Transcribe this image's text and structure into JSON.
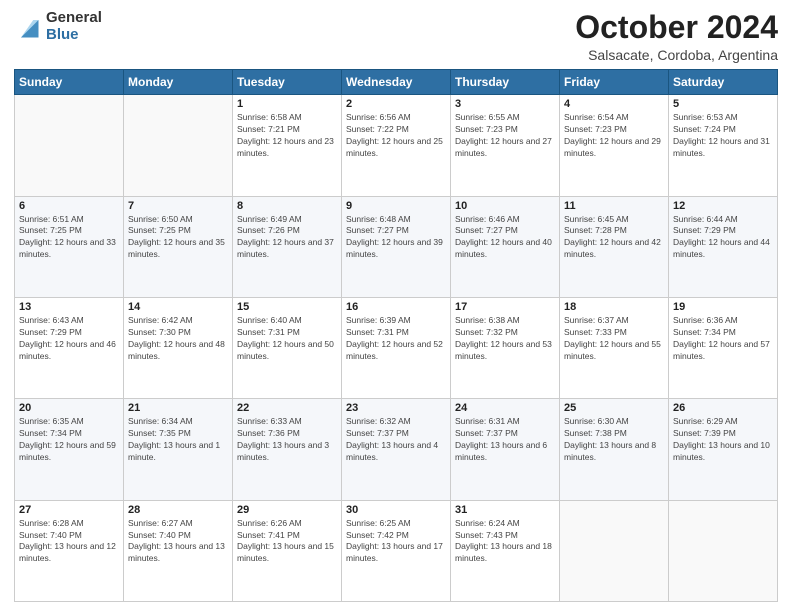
{
  "logo": {
    "general": "General",
    "blue": "Blue"
  },
  "header": {
    "title": "October 2024",
    "subtitle": "Salsacate, Cordoba, Argentina"
  },
  "weekdays": [
    "Sunday",
    "Monday",
    "Tuesday",
    "Wednesday",
    "Thursday",
    "Friday",
    "Saturday"
  ],
  "weeks": [
    [
      {
        "day": "",
        "info": ""
      },
      {
        "day": "",
        "info": ""
      },
      {
        "day": "1",
        "info": "Sunrise: 6:58 AM\nSunset: 7:21 PM\nDaylight: 12 hours and 23 minutes."
      },
      {
        "day": "2",
        "info": "Sunrise: 6:56 AM\nSunset: 7:22 PM\nDaylight: 12 hours and 25 minutes."
      },
      {
        "day": "3",
        "info": "Sunrise: 6:55 AM\nSunset: 7:23 PM\nDaylight: 12 hours and 27 minutes."
      },
      {
        "day": "4",
        "info": "Sunrise: 6:54 AM\nSunset: 7:23 PM\nDaylight: 12 hours and 29 minutes."
      },
      {
        "day": "5",
        "info": "Sunrise: 6:53 AM\nSunset: 7:24 PM\nDaylight: 12 hours and 31 minutes."
      }
    ],
    [
      {
        "day": "6",
        "info": "Sunrise: 6:51 AM\nSunset: 7:25 PM\nDaylight: 12 hours and 33 minutes."
      },
      {
        "day": "7",
        "info": "Sunrise: 6:50 AM\nSunset: 7:25 PM\nDaylight: 12 hours and 35 minutes."
      },
      {
        "day": "8",
        "info": "Sunrise: 6:49 AM\nSunset: 7:26 PM\nDaylight: 12 hours and 37 minutes."
      },
      {
        "day": "9",
        "info": "Sunrise: 6:48 AM\nSunset: 7:27 PM\nDaylight: 12 hours and 39 minutes."
      },
      {
        "day": "10",
        "info": "Sunrise: 6:46 AM\nSunset: 7:27 PM\nDaylight: 12 hours and 40 minutes."
      },
      {
        "day": "11",
        "info": "Sunrise: 6:45 AM\nSunset: 7:28 PM\nDaylight: 12 hours and 42 minutes."
      },
      {
        "day": "12",
        "info": "Sunrise: 6:44 AM\nSunset: 7:29 PM\nDaylight: 12 hours and 44 minutes."
      }
    ],
    [
      {
        "day": "13",
        "info": "Sunrise: 6:43 AM\nSunset: 7:29 PM\nDaylight: 12 hours and 46 minutes."
      },
      {
        "day": "14",
        "info": "Sunrise: 6:42 AM\nSunset: 7:30 PM\nDaylight: 12 hours and 48 minutes."
      },
      {
        "day": "15",
        "info": "Sunrise: 6:40 AM\nSunset: 7:31 PM\nDaylight: 12 hours and 50 minutes."
      },
      {
        "day": "16",
        "info": "Sunrise: 6:39 AM\nSunset: 7:31 PM\nDaylight: 12 hours and 52 minutes."
      },
      {
        "day": "17",
        "info": "Sunrise: 6:38 AM\nSunset: 7:32 PM\nDaylight: 12 hours and 53 minutes."
      },
      {
        "day": "18",
        "info": "Sunrise: 6:37 AM\nSunset: 7:33 PM\nDaylight: 12 hours and 55 minutes."
      },
      {
        "day": "19",
        "info": "Sunrise: 6:36 AM\nSunset: 7:34 PM\nDaylight: 12 hours and 57 minutes."
      }
    ],
    [
      {
        "day": "20",
        "info": "Sunrise: 6:35 AM\nSunset: 7:34 PM\nDaylight: 12 hours and 59 minutes."
      },
      {
        "day": "21",
        "info": "Sunrise: 6:34 AM\nSunset: 7:35 PM\nDaylight: 13 hours and 1 minute."
      },
      {
        "day": "22",
        "info": "Sunrise: 6:33 AM\nSunset: 7:36 PM\nDaylight: 13 hours and 3 minutes."
      },
      {
        "day": "23",
        "info": "Sunrise: 6:32 AM\nSunset: 7:37 PM\nDaylight: 13 hours and 4 minutes."
      },
      {
        "day": "24",
        "info": "Sunrise: 6:31 AM\nSunset: 7:37 PM\nDaylight: 13 hours and 6 minutes."
      },
      {
        "day": "25",
        "info": "Sunrise: 6:30 AM\nSunset: 7:38 PM\nDaylight: 13 hours and 8 minutes."
      },
      {
        "day": "26",
        "info": "Sunrise: 6:29 AM\nSunset: 7:39 PM\nDaylight: 13 hours and 10 minutes."
      }
    ],
    [
      {
        "day": "27",
        "info": "Sunrise: 6:28 AM\nSunset: 7:40 PM\nDaylight: 13 hours and 12 minutes."
      },
      {
        "day": "28",
        "info": "Sunrise: 6:27 AM\nSunset: 7:40 PM\nDaylight: 13 hours and 13 minutes."
      },
      {
        "day": "29",
        "info": "Sunrise: 6:26 AM\nSunset: 7:41 PM\nDaylight: 13 hours and 15 minutes."
      },
      {
        "day": "30",
        "info": "Sunrise: 6:25 AM\nSunset: 7:42 PM\nDaylight: 13 hours and 17 minutes."
      },
      {
        "day": "31",
        "info": "Sunrise: 6:24 AM\nSunset: 7:43 PM\nDaylight: 13 hours and 18 minutes."
      },
      {
        "day": "",
        "info": ""
      },
      {
        "day": "",
        "info": ""
      }
    ]
  ]
}
